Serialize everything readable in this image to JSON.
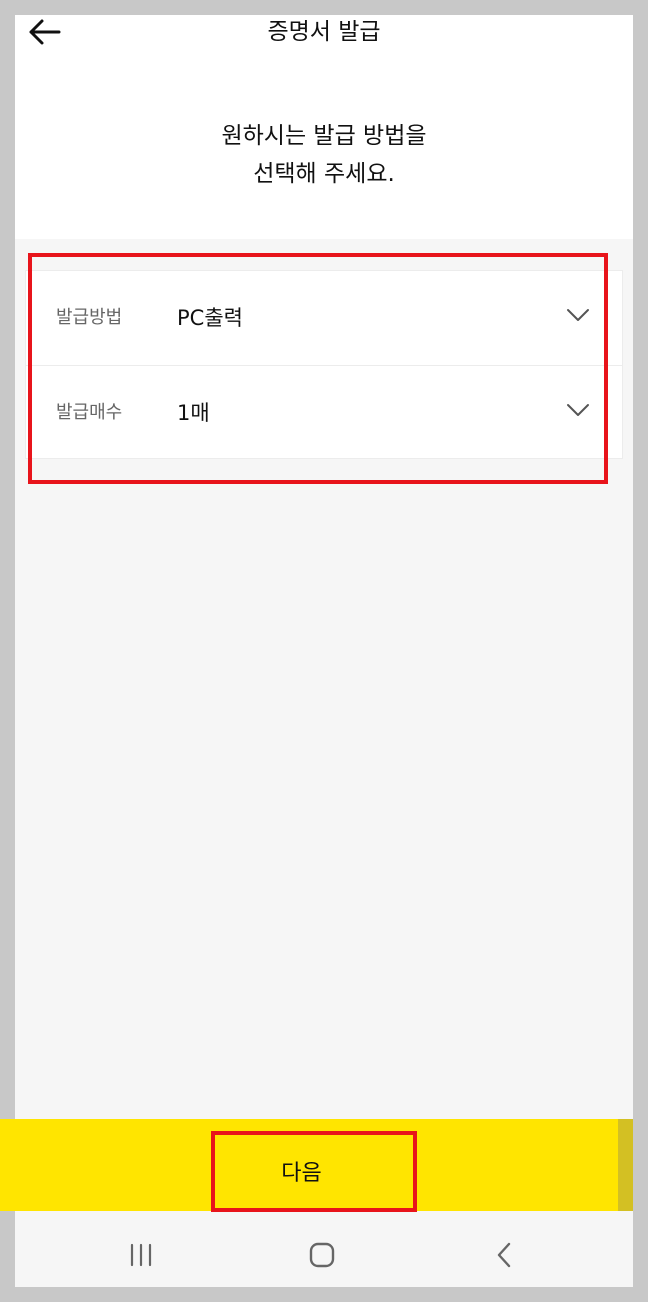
{
  "header": {
    "title": "증명서 발급",
    "back_icon": "arrow-left-icon"
  },
  "instruction": {
    "line1": "원하시는 발급 방법을",
    "line2": "선택해 주세요."
  },
  "options": [
    {
      "label": "발급방법",
      "value": "PC출력",
      "icon": "chevron-down-icon"
    },
    {
      "label": "발급매수",
      "value": "1매",
      "icon": "chevron-down-icon"
    }
  ],
  "footer": {
    "next_label": "다음"
  },
  "nav": {
    "recent_icon": "recent-apps-icon",
    "home_icon": "home-icon",
    "back_icon": "back-icon"
  },
  "colors": {
    "accent": "#ffe500",
    "highlight": "#e8141b",
    "background": "#f6f6f6"
  }
}
